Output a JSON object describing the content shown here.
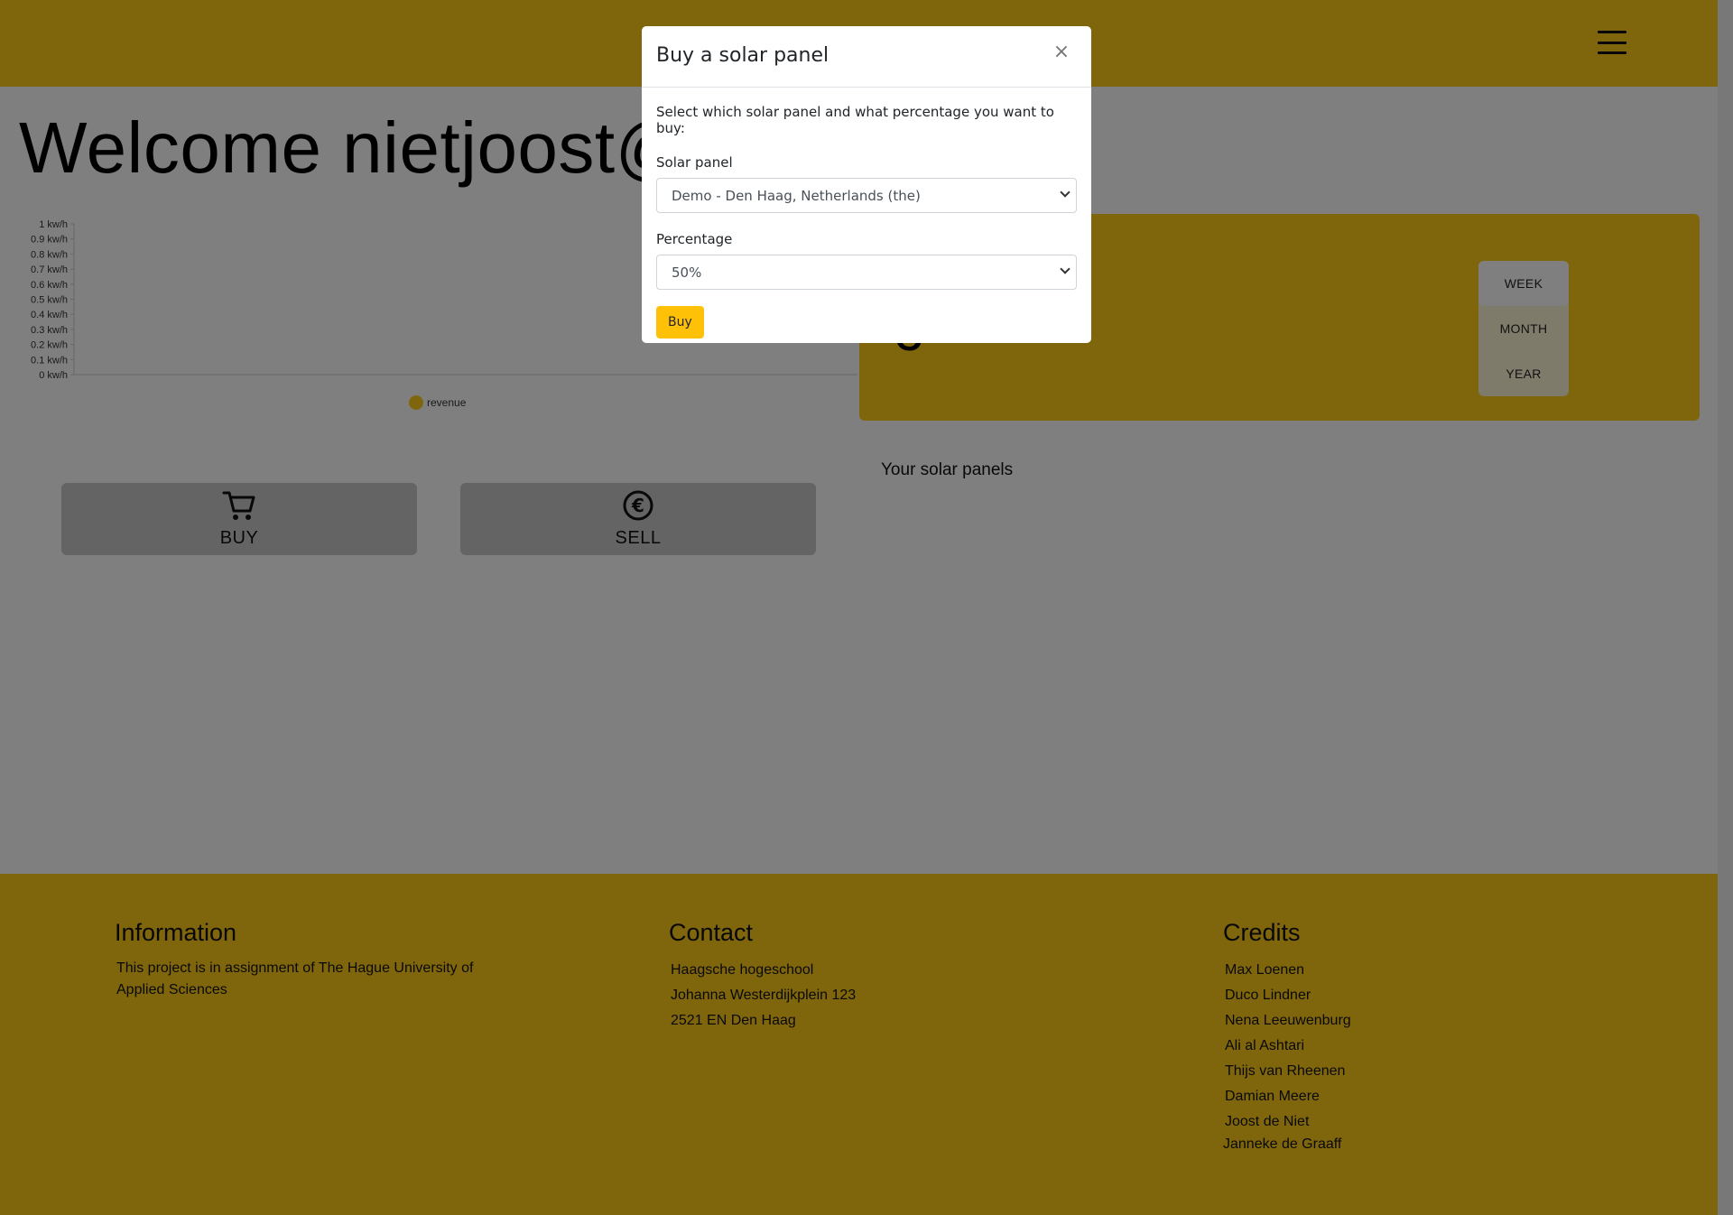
{
  "header": {
    "menu_icon": "hamburger-menu-icon"
  },
  "welcome": {
    "text": "Welcome nietjoost@"
  },
  "chart_data": {
    "type": "line",
    "y_ticks": [
      "1 kw/h",
      "0.9 kw/h",
      "0.8 kw/h",
      "0.7 kw/h",
      "0.6 kw/h",
      "0.5 kw/h",
      "0.4 kw/h",
      "0.3 kw/h",
      "0.2 kw/h",
      "0.1 kw/h",
      "0 kw/h"
    ],
    "ylim": [
      0,
      1
    ],
    "series": [
      {
        "name": "revenue",
        "values": []
      }
    ],
    "legend": "bottom",
    "colors": {
      "revenue": "#ffcc1a"
    }
  },
  "actions": {
    "buy_label": "BUY",
    "buy_icon": "shopping-cart-icon",
    "sell_label": "SELL",
    "sell_icon": "euro-icon"
  },
  "summary": {
    "currency_glyph": "€",
    "periods": [
      {
        "label": "WEEK",
        "active": true
      },
      {
        "label": "MONTH",
        "active": false
      },
      {
        "label": "YEAR",
        "active": false
      }
    ]
  },
  "panels": {
    "title": "Your solar panels"
  },
  "footer": {
    "information": {
      "title": "Information",
      "text": "This project is in assignment of The Hague University of Applied Sciences"
    },
    "contact": {
      "title": "Contact",
      "lines": [
        "Haagsche hogeschool",
        "Johanna Westerdijkplein 123",
        "2521 EN Den Haag"
      ]
    },
    "credits": {
      "title": "Credits",
      "names": [
        "Max Loenen",
        "Duco Lindner",
        "Nena Leeuwenburg",
        "Ali al Ashtari",
        "Thijs van Rheenen",
        "Damian Meere",
        "Joost de Niet",
        "Janneke de Graaff"
      ]
    }
  },
  "modal": {
    "title": "Buy a solar panel",
    "close_glyph": "×",
    "intro": "Select which solar panel and what percentage you want to buy:",
    "panel_label": "Solar panel",
    "panel_value": "Demo - Den Haag, Netherlands (the)",
    "percentage_label": "Percentage",
    "percentage_value": "50%",
    "submit_label": "Buy"
  },
  "colors": {
    "brand_yellow": "#ffcc1a",
    "button_yellow": "#ffc107",
    "backdrop": "rgba(0,0,0,0.5)"
  }
}
